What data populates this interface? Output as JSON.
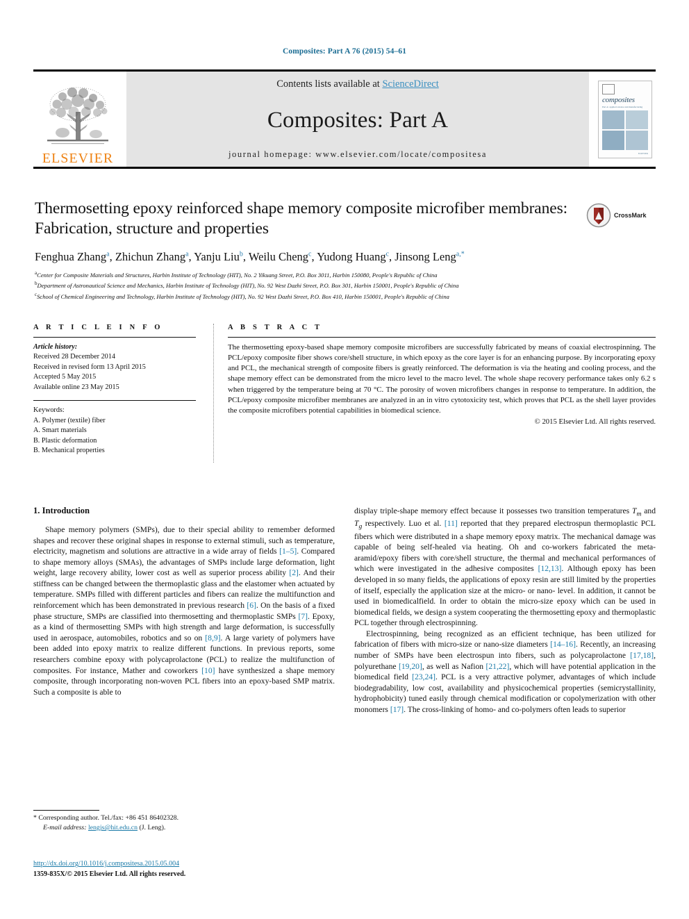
{
  "running_head": "Composites: Part A 76 (2015) 54–61",
  "masthead": {
    "publisher_name": "ELSEVIER",
    "contents_prefix": "Contents lists available at ",
    "contents_link": "ScienceDirect",
    "journal_title": "Composites: Part A",
    "homepage": "journal homepage: www.elsevier.com/locate/compositesa",
    "cover": {
      "title": "composites",
      "subtitle": "Part A: applied science and manufacturing",
      "footer": "ELSEVIER"
    }
  },
  "article": {
    "title": "Thermosetting epoxy reinforced shape memory composite microfiber membranes: Fabrication, structure and properties",
    "crossmark_label": "CrossMark",
    "authors": [
      {
        "name": "Fenghua Zhang",
        "marks": "a"
      },
      {
        "name": "Zhichun Zhang",
        "marks": "a"
      },
      {
        "name": "Yanju Liu",
        "marks": "b"
      },
      {
        "name": "Weilu Cheng",
        "marks": "c"
      },
      {
        "name": "Yudong Huang",
        "marks": "c"
      },
      {
        "name": "Jinsong Leng",
        "marks": "a,*"
      }
    ],
    "affiliations": [
      {
        "mark": "a",
        "text": "Center for Composite Materials and Structures, Harbin Institute of Technology (HIT), No. 2 Yikuang Street, P.O. Box 3011, Harbin 150080, People's Republic of China"
      },
      {
        "mark": "b",
        "text": "Department of Astronautical Science and Mechanics, Harbin Institute of Technology (HIT), No. 92 West Dazhi Street, P.O. Box 301, Harbin 150001, People's Republic of China"
      },
      {
        "mark": "c",
        "text": "School of Chemical Engineering and Technology, Harbin Institute of Technology (HIT), No. 92 West Dazhi Street, P.O. Box 410, Harbin 150001, People's Republic of China"
      }
    ]
  },
  "article_info": {
    "heading": "A R T I C L E   I N F O",
    "history_label": "Article history:",
    "history": [
      "Received 28 December 2014",
      "Received in revised form 13 April 2015",
      "Accepted 5 May 2015",
      "Available online 23 May 2015"
    ],
    "keywords_label": "Keywords:",
    "keywords": [
      "A. Polymer (textile) fiber",
      "A. Smart materials",
      "B. Plastic deformation",
      "B. Mechanical properties"
    ]
  },
  "abstract": {
    "heading": "A B S T R A C T",
    "text": "The thermosetting epoxy-based shape memory composite microfibers are successfully fabricated by means of coaxial electrospinning. The PCL/epoxy composite fiber shows core/shell structure, in which epoxy as the core layer is for an enhancing purpose. By incorporating epoxy and PCL, the mechanical strength of composite fibers is greatly reinforced. The deformation is via the heating and cooling process, and the shape memory effect can be demonstrated from the micro level to the macro level. The whole shape recovery performance takes only 6.2 s when triggered by the temperature being at 70 °C. The porosity of woven microfibers changes in response to temperature. In addition, the PCL/epoxy composite microfiber membranes are analyzed in an in vitro cytotoxicity test, which proves that PCL as the shell layer provides the composite microfibers potential capabilities in biomedical science.",
    "copyright": "© 2015 Elsevier Ltd. All rights reserved."
  },
  "body": {
    "section_heading": "1. Introduction",
    "left_paragraph_1": "Shape memory polymers (SMPs), due to their special ability to remember deformed shapes and recover these original shapes in response to external stimuli, such as temperature, electricity, magnetism and solutions are attractive in a wide array of fields [1–5]. Compared to shape memory alloys (SMAs), the advantages of SMPs include large deformation, light weight, large recovery ability, lower cost as well as superior process ability [2]. And their stiffness can be changed between the thermoplastic glass and the elastomer when actuated by temperature. SMPs filled with different particles and fibers can realize the multifunction and reinforcement which has been demonstrated in previous research [6]. On the basis of a fixed phase structure, SMPs are classified into thermosetting and thermoplastic SMPs [7]. Epoxy, as a kind of thermosetting SMPs with high strength and large deformation, is successfully used in aerospace, automobiles, robotics and so on [8,9]. A large variety of polymers have been added into epoxy matrix to realize different functions. In previous reports, some researchers combine epoxy with polycaprolactone (PCL) to realize the multifunction of composites. For instance, Mather and coworkers [10] have synthesized a shape memory composite, through incorporating non-woven PCL fibers into an epoxy-based SMP matrix. Such a composite is able to",
    "right_paragraph_1": "display triple-shape memory effect because it possesses two transition temperatures Tm and Tg respectively. Luo et al. [11] reported that they prepared electrospun thermoplastic PCL fibers which were distributed in a shape memory epoxy matrix. The mechanical damage was capable of being self-healed via heating. Oh and co-workers fabricated the meta-aramid/epoxy fibers with core/shell structure, the thermal and mechanical performances of which were investigated in the adhesive composites [12,13]. Although epoxy has been developed in so many fields, the applications of epoxy resin are still limited by the properties of itself, especially the application size at the micro- or nano- level. In addition, it cannot be used in biomedicalfield. In order to obtain the micro-size epoxy which can be used in biomedical fields, we design a system cooperating the thermosetting epoxy and thermoplastic PCL together through electrospinning.",
    "right_paragraph_2": "Electrospinning, being recognized as an efficient technique, has been utilized for fabrication of fibers with micro-size or nano-size diameters [14–16]. Recently, an increasing number of SMPs have been electrospun into fibers, such as polycaprolactone [17,18], polyurethane [19,20], as well as Nafion [21,22], which will have potential application in the biomedical field [23,24]. PCL is a very attractive polymer, advantages of which include biodegradability, low cost, availability and physicochemical properties (semicrystallinity, hydrophobicity) tuned easily through chemical modification or copolymerization with other monomers [17]. The cross-linking of homo- and co-polymers often leads to superior"
  },
  "footer": {
    "corresponding_marker": "*",
    "corresponding_text": "Corresponding author. Tel./fax: +86 451 86402328.",
    "email_label": "E-mail address:",
    "email": "lengjs@hit.edu.cn",
    "email_owner": "(J. Leng).",
    "doi": "http://dx.doi.org/10.1016/j.compositesa.2015.05.004",
    "issn_line": "1359-835X/© 2015 Elsevier Ltd. All rights reserved."
  },
  "colors": {
    "link": "#1a7aa8",
    "header_band": "#e4e4e4",
    "elsevier_orange": "#ee8315",
    "sciencedirect": "#3a8fc0"
  }
}
